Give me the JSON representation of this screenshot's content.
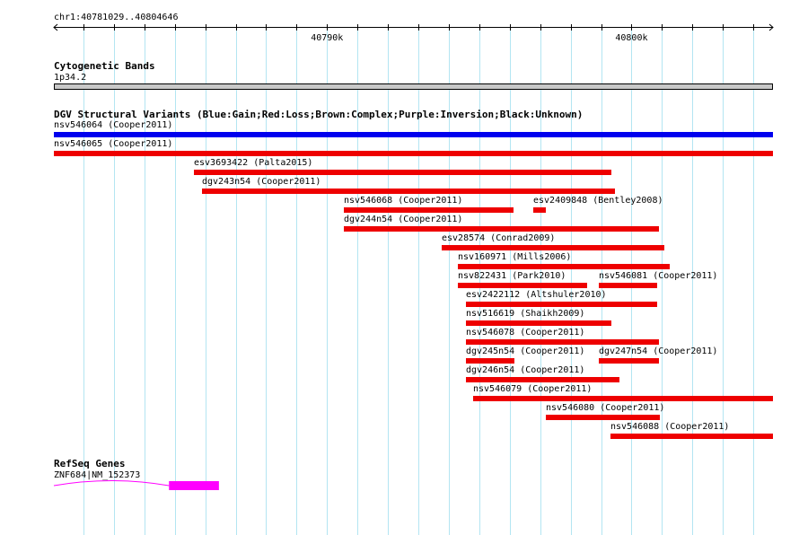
{
  "ruler": {
    "location": "chr1:40781029..40804646",
    "ticks": [
      {
        "label": "40790k",
        "pos": 40790000
      },
      {
        "label": "40800k",
        "pos": 40800000
      }
    ]
  },
  "tracks": {
    "cytoband": {
      "title": "Cytogenetic Bands",
      "band_label": "1p34.2",
      "band_color": "#c8c8c8"
    },
    "dgv": {
      "title": "DGV Structural Variants (Blue:Gain;Red:Loss;Brown:Complex;Purple:Inversion;Black:Unknown)",
      "colors": {
        "gain": "#0000ee",
        "loss": "#ee0000"
      },
      "features": [
        {
          "label": "nsv546064 (Cooper2011)",
          "type": "gain",
          "start": 40781029,
          "end": 40804646
        },
        {
          "label": "nsv546065 (Cooper2011)",
          "type": "loss",
          "start": 40781029,
          "end": 40804646
        },
        {
          "label": "esv3693422 (Palta2015)",
          "type": "loss",
          "start": 40785630,
          "end": 40799340
        },
        {
          "label": "dgv243n54 (Cooper2011)",
          "type": "loss",
          "start": 40785880,
          "end": 40799430
        },
        {
          "label": "nsv546068 (Cooper2011)",
          "type": "loss",
          "start": 40790560,
          "end": 40796140
        },
        {
          "label": "esv2409848 (Bentley2008)",
          "type": "loss",
          "start": 40796760,
          "end": 40797170
        },
        {
          "label": "dgv244n54 (Cooper2011)",
          "type": "loss",
          "start": 40790560,
          "end": 40800910
        },
        {
          "label": "esv28574 (Conrad2009)",
          "type": "loss",
          "start": 40793770,
          "end": 40801090
        },
        {
          "label": "nsv160971 (Mills2006)",
          "type": "loss",
          "start": 40794290,
          "end": 40801240
        },
        {
          "label": "nsv822431 (Park2010)",
          "type": "loss",
          "start": 40794290,
          "end": 40798550
        },
        {
          "label": "nsv546081 (Cooper2011)",
          "type": "loss",
          "start": 40798930,
          "end": 40800850
        },
        {
          "label": "esv2422112 (Altshuler2010)",
          "type": "loss",
          "start": 40794560,
          "end": 40800850
        },
        {
          "label": "nsv516619 (Shaikh2009)",
          "type": "loss",
          "start": 40794560,
          "end": 40799340
        },
        {
          "label": "nsv546078 (Cooper2011)",
          "type": "loss",
          "start": 40794560,
          "end": 40800910
        },
        {
          "label": "dgv245n54 (Cooper2011)",
          "type": "loss",
          "start": 40794560,
          "end": 40796140
        },
        {
          "label": "dgv247n54 (Cooper2011)",
          "type": "loss",
          "start": 40798930,
          "end": 40800910
        },
        {
          "label": "dgv246n54 (Cooper2011)",
          "type": "loss",
          "start": 40794560,
          "end": 40799610
        },
        {
          "label": "nsv546079 (Cooper2011)",
          "type": "loss",
          "start": 40794790,
          "end": 40804646
        },
        {
          "label": "nsv546080 (Cooper2011)",
          "type": "loss",
          "start": 40797180,
          "end": 40800910
        },
        {
          "label": "nsv546088 (Cooper2011)",
          "type": "loss",
          "start": 40799310,
          "end": 40804646
        }
      ]
    },
    "refseq": {
      "title": "RefSeq Genes",
      "gene_label": "ZNF684|NM_152373",
      "gene_color": "#ff00ff",
      "intron_start": 40781029,
      "exon_start": 40784810,
      "exon_end": 40786450
    }
  }
}
